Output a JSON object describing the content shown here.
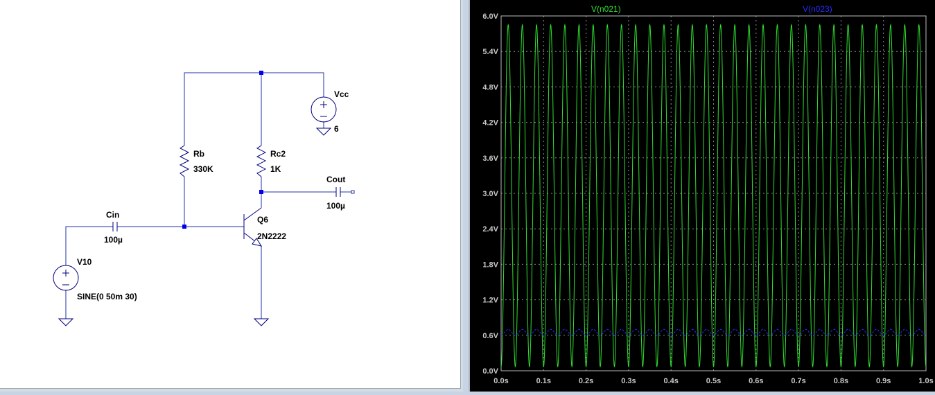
{
  "schematic": {
    "components": {
      "vcc": {
        "name": "Vcc",
        "value": "6"
      },
      "rb": {
        "name": "Rb",
        "value": "330K"
      },
      "rc": {
        "name": "Rc2",
        "value": "1K"
      },
      "cout": {
        "name": "Cout",
        "value": "100µ"
      },
      "cin": {
        "name": "Cin",
        "value": "100µ"
      },
      "q": {
        "name": "Q6",
        "value": "2N2222"
      },
      "v10": {
        "name": "V10",
        "value": "SINE(0 50m 30)"
      }
    },
    "colors": {
      "wire": "#2233aa",
      "node": "#0000ee",
      "symbol": "#000080"
    }
  },
  "waveform": {
    "traces": [
      {
        "label": "V(n021)",
        "color": "#30e030"
      },
      {
        "label": "V(n023)",
        "color": "#2a2aff"
      }
    ],
    "chart_data": {
      "type": "line",
      "xlabel": "",
      "ylabel": "",
      "xlim": [
        0.0,
        1.0
      ],
      "ylim": [
        0.0,
        6.0
      ],
      "yticks": [
        "0.0V",
        "0.6V",
        "1.2V",
        "1.8V",
        "2.4V",
        "3.0V",
        "3.6V",
        "4.2V",
        "4.8V",
        "5.4V",
        "6.0V"
      ],
      "xticks": [
        "0.0s",
        "0.1s",
        "0.2s",
        "0.3s",
        "0.4s",
        "0.5s",
        "0.6s",
        "0.7s",
        "0.8s",
        "0.9s",
        "1.0s"
      ],
      "grid": true,
      "series": [
        {
          "name": "V(n021)",
          "waveform": "sine",
          "frequency_hz": 30,
          "min": 0.07,
          "max": 5.85
        },
        {
          "name": "V(n023)",
          "waveform": "sine",
          "frequency_hz": 30,
          "min": 0.6,
          "max": 0.7
        }
      ]
    }
  }
}
